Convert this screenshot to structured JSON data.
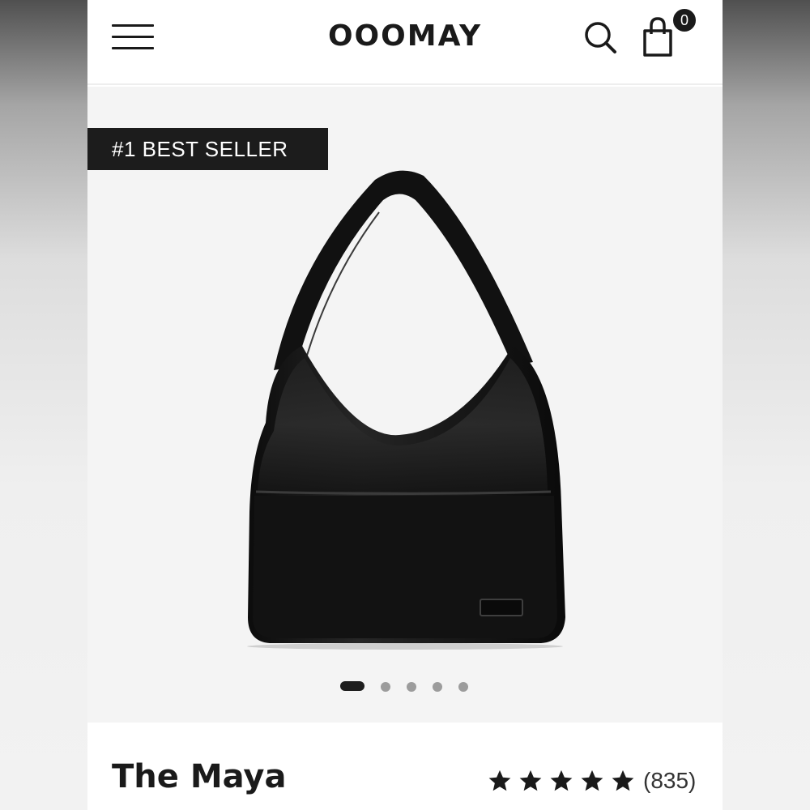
{
  "header": {
    "brand": "OOOMAY",
    "cart_count": "0",
    "icons": [
      "menu-icon",
      "search-icon",
      "shopping-bag-icon"
    ]
  },
  "gallery": {
    "badge": "#1 BEST SELLER",
    "image_count": 5,
    "active_image": 1
  },
  "product": {
    "title": "The Maya",
    "rating_stars": 5,
    "review_count": "(835)"
  },
  "colors": {
    "text": "#1a1a1a",
    "badge_bg": "#1c1c1c",
    "gallery_bg": "#f4f4f4",
    "dot_inactive": "#9c9c9c"
  }
}
